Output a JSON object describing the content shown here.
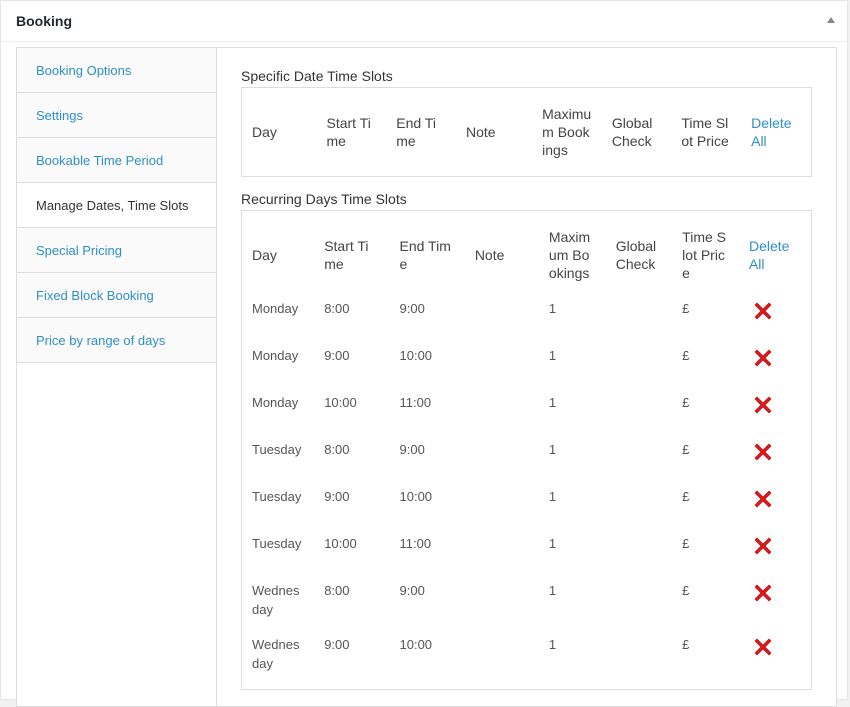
{
  "box": {
    "title": "Booking"
  },
  "tabs": [
    {
      "label": "Booking Options",
      "active": false
    },
    {
      "label": "Settings",
      "active": false
    },
    {
      "label": "Bookable Time Period",
      "active": false
    },
    {
      "label": "Manage Dates, Time Slots",
      "active": true
    },
    {
      "label": "Special Pricing",
      "active": false
    },
    {
      "label": "Fixed Block Booking",
      "active": false
    },
    {
      "label": "Price by range of days",
      "active": false
    }
  ],
  "specific": {
    "title": "Specific Date Time Slots",
    "headers": {
      "day": "Day",
      "start": "Start Time",
      "end": "End Time",
      "note": "Note",
      "max": "Maximum Bookings",
      "global": "Global Check",
      "price": "Time Slot Price",
      "delete_all": "Delete All"
    }
  },
  "recurring": {
    "title": "Recurring Days Time Slots",
    "headers": {
      "day": "Day",
      "start": "Start Time",
      "end": "End Time",
      "note": "Note",
      "max": "Maximum Bookings",
      "global": "Global Check",
      "price": "Time Slot Price",
      "delete_all": "Delete All"
    },
    "rows": [
      {
        "day": "Monday",
        "start": "8:00",
        "end": "9:00",
        "note": "",
        "max": "1",
        "global": "",
        "price": "£"
      },
      {
        "day": "Monday",
        "start": "9:00",
        "end": "10:00",
        "note": "",
        "max": "1",
        "global": "",
        "price": "£"
      },
      {
        "day": "Monday",
        "start": "10:00",
        "end": "11:00",
        "note": "",
        "max": "1",
        "global": "",
        "price": "£"
      },
      {
        "day": "Tuesday",
        "start": "8:00",
        "end": "9:00",
        "note": "",
        "max": "1",
        "global": "",
        "price": "£"
      },
      {
        "day": "Tuesday",
        "start": "9:00",
        "end": "10:00",
        "note": "",
        "max": "1",
        "global": "",
        "price": "£"
      },
      {
        "day": "Tuesday",
        "start": "10:00",
        "end": "11:00",
        "note": "",
        "max": "1",
        "global": "",
        "price": "£"
      },
      {
        "day": "Wednesday",
        "start": "8:00",
        "end": "9:00",
        "note": "",
        "max": "1",
        "global": "",
        "price": "£"
      },
      {
        "day": "Wednesday",
        "start": "9:00",
        "end": "10:00",
        "note": "",
        "max": "1",
        "global": "",
        "price": "£"
      }
    ]
  },
  "colors": {
    "link": "#2e8fc6",
    "delete": "#e0191c"
  },
  "icons": {
    "delete": "delete-x-icon",
    "toggle": "toggle-up-arrow-icon"
  }
}
